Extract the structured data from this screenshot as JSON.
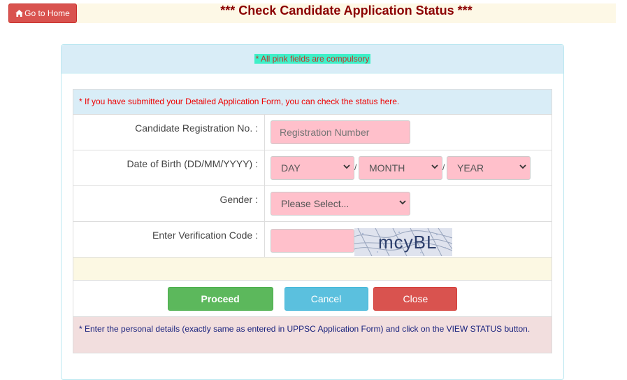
{
  "header": {
    "home_label": "Go to Home",
    "title": "*** Check Candidate Application Status ***"
  },
  "panel": {
    "compulsory_note": "* All pink fields are compulsory",
    "info_text": "* If you have submitted your Detailed Application Form, you can check the status here."
  },
  "form": {
    "registration": {
      "label": "Candidate Registration No. :",
      "placeholder": "Registration Number",
      "value": ""
    },
    "dob": {
      "label": "Date of Birth (DD/MM/YYYY) :",
      "day": "DAY",
      "month": "MONTH",
      "year": "YEAR",
      "separator": "/"
    },
    "gender": {
      "label": "Gender :",
      "selected": "Please Select..."
    },
    "captcha": {
      "label": "Enter Verification Code :",
      "value": "",
      "image_text": "mcyBL"
    }
  },
  "buttons": {
    "proceed": "Proceed",
    "cancel": "Cancel",
    "close": "Close"
  },
  "footer_note": "* Enter the personal details (exactly same as entered in UPPSC Application Form) and click on the VIEW STATUS button.",
  "colors": {
    "title": "#8b0000",
    "pink_field": "#ffc0cb",
    "proceed": "#5cb85c",
    "cancel": "#5bc0de",
    "close": "#d9534f"
  }
}
